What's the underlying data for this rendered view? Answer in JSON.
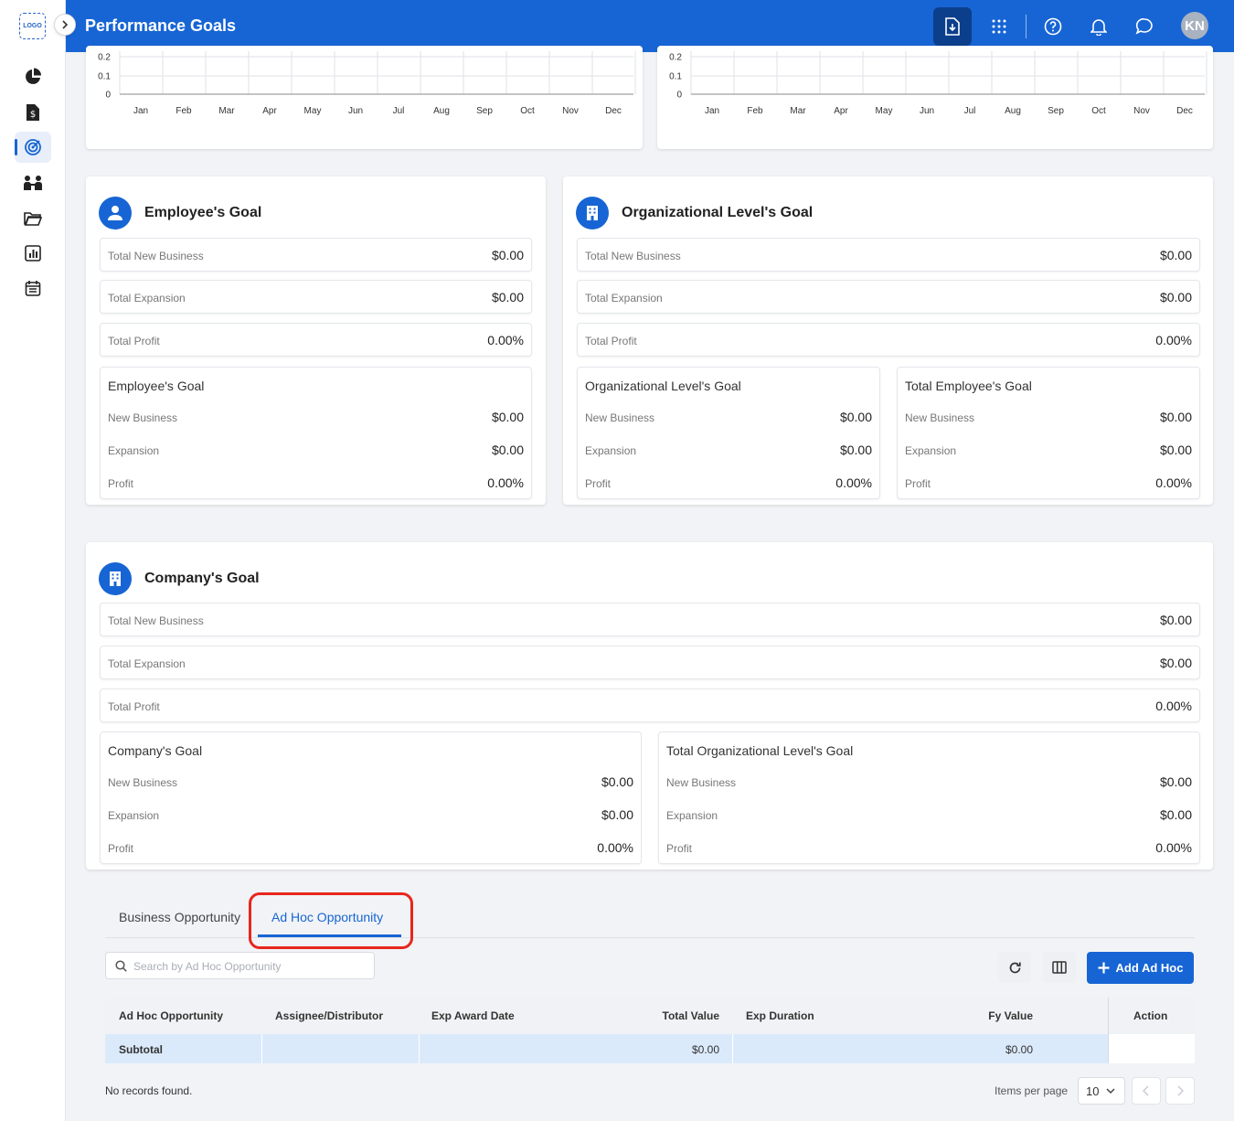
{
  "app": {
    "logo_text": "LOGO",
    "page_title": "Performance Goals",
    "avatar_initials": "KN"
  },
  "icons": {
    "sidebar": [
      "pie-chart-icon",
      "invoice-icon",
      "target-icon",
      "team-icon",
      "folder-icon",
      "bar-chart-icon",
      "calendar-icon"
    ],
    "topbar": [
      "download-icon",
      "apps-grid-icon",
      "help-icon",
      "bell-icon",
      "chat-icon"
    ]
  },
  "colors": {
    "primary": "#1765d4",
    "highlight": "#e8261c",
    "subtotal_bg": "#dbeafb"
  },
  "charts": {
    "y_ticks": [
      "0.2",
      "0.1",
      "0"
    ],
    "months": [
      "Jan",
      "Feb",
      "Mar",
      "Apr",
      "May",
      "Jun",
      "Jul",
      "Aug",
      "Sep",
      "Oct",
      "Nov",
      "Dec"
    ]
  },
  "employee_goal": {
    "title": "Employee's Goal",
    "totals": [
      {
        "label": "Total New Business",
        "value": "$0.00"
      },
      {
        "label": "Total Expansion",
        "value": "$0.00"
      },
      {
        "label": "Total Profit",
        "value": "0.00%"
      }
    ],
    "breakdown": {
      "title": "Employee's Goal",
      "rows": [
        {
          "label": "New Business",
          "value": "$0.00"
        },
        {
          "label": "Expansion",
          "value": "$0.00"
        },
        {
          "label": "Profit",
          "value": "0.00%"
        }
      ]
    }
  },
  "org_goal": {
    "title": "Organizational Level's Goal",
    "totals": [
      {
        "label": "Total New Business",
        "value": "$0.00"
      },
      {
        "label": "Total Expansion",
        "value": "$0.00"
      },
      {
        "label": "Total Profit",
        "value": "0.00%"
      }
    ],
    "breakdowns": [
      {
        "title": "Organizational Level's Goal",
        "rows": [
          {
            "label": "New Business",
            "value": "$0.00"
          },
          {
            "label": "Expansion",
            "value": "$0.00"
          },
          {
            "label": "Profit",
            "value": "0.00%"
          }
        ]
      },
      {
        "title": "Total Employee's Goal",
        "rows": [
          {
            "label": "New Business",
            "value": "$0.00"
          },
          {
            "label": "Expansion",
            "value": "$0.00"
          },
          {
            "label": "Profit",
            "value": "0.00%"
          }
        ]
      }
    ]
  },
  "company_goal": {
    "title": "Company's Goal",
    "totals": [
      {
        "label": "Total New Business",
        "value": "$0.00"
      },
      {
        "label": "Total Expansion",
        "value": "$0.00"
      },
      {
        "label": "Total Profit",
        "value": "0.00%"
      }
    ],
    "breakdowns": [
      {
        "title": "Company's Goal",
        "rows": [
          {
            "label": "New Business",
            "value": "$0.00"
          },
          {
            "label": "Expansion",
            "value": "$0.00"
          },
          {
            "label": "Profit",
            "value": "0.00%"
          }
        ]
      },
      {
        "title": "Total Organizational Level's Goal",
        "rows": [
          {
            "label": "New Business",
            "value": "$0.00"
          },
          {
            "label": "Expansion",
            "value": "$0.00"
          },
          {
            "label": "Profit",
            "value": "0.00%"
          }
        ]
      }
    ]
  },
  "tabs": [
    {
      "label": "Business Opportunity",
      "active": false
    },
    {
      "label": "Ad Hoc Opportunity",
      "active": true
    }
  ],
  "toolbar": {
    "search_placeholder": "Search by Ad Hoc Opportunity",
    "add_label": "Add Ad Hoc"
  },
  "table": {
    "headers": [
      "Ad Hoc Opportunity",
      "Assignee/Distributor",
      "Exp Award Date",
      "Total Value",
      "Exp Duration",
      "Fy Value",
      "Action"
    ],
    "subtotal": {
      "label": "Subtotal",
      "total_value": "$0.00",
      "fy_value": "$0.00"
    },
    "empty_text": "No records found."
  },
  "pagination": {
    "items_per_page_label": "Items per page",
    "items_per_page": "10"
  }
}
